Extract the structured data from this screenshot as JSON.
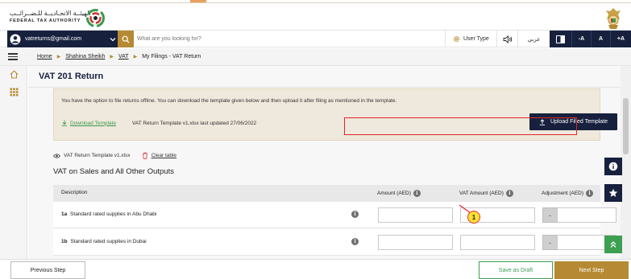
{
  "header": {
    "logo_text_ar": "الهيئــة الاتحـاديــة للـضــرائــب",
    "logo_text_en": "FEDERAL TAX AUTHORITY"
  },
  "nav": {
    "account_email": "vatreturns@gmail.com",
    "search_placeholder": "What are you looking for?",
    "user_type_label": "User Type",
    "arabic_label": "عربي",
    "font_decrease": "-A",
    "font_normal": "A",
    "font_increase": "+A"
  },
  "breadcrumb": {
    "home": "Home",
    "user": "Shahina Sheikh",
    "vat": "VAT",
    "filings": "My Filings - VAT Return"
  },
  "page": {
    "title": "VAT 201 Return"
  },
  "notice": {
    "text": "You have the option to file returns offline. You can download the template given below and then upload it after filing as mentioned in the template.",
    "download_label": "Download Template",
    "template_info": "VAT Return Template v1.xlsx last updated 27/06/2022",
    "upload_label": "Upload Filled Template"
  },
  "file": {
    "name": "VAT Return Template v1.xlsx",
    "clear_label": "Clear table"
  },
  "section": {
    "title": "VAT on Sales and All Other Outputs"
  },
  "table": {
    "headers": {
      "description": "Description",
      "amount": "Amount (AED)",
      "vat_amount": "VAT Amount (AED)",
      "adjustment": "Adjustment (AED)"
    },
    "rows": [
      {
        "code": "1a",
        "label": "Standard rated supplies in Abu Dhabi"
      },
      {
        "code": "1b",
        "label": "Standard rated supplies in Dubai"
      }
    ],
    "adjust_symbol": "-"
  },
  "annotation": {
    "callout_number": "1",
    "highlight_color": "#e0262a"
  },
  "footer": {
    "previous_label": "Previous Step",
    "draft_label": "Save as Draft",
    "next_label": "Next Step"
  },
  "colors": {
    "navy": "#17213e",
    "gold": "#b68a35",
    "green": "#3c9f52",
    "notice_bg": "#efe8dc"
  },
  "icons": [
    "user-icon",
    "chevron-down-icon",
    "search-icon",
    "gear-icon",
    "speaker-icon",
    "contrast-icon",
    "menu-icon",
    "home-icon",
    "grid-icon",
    "download-icon",
    "upload-icon",
    "eye-icon",
    "trash-icon",
    "info-icon",
    "star-icon",
    "chevrons-up-icon"
  ]
}
